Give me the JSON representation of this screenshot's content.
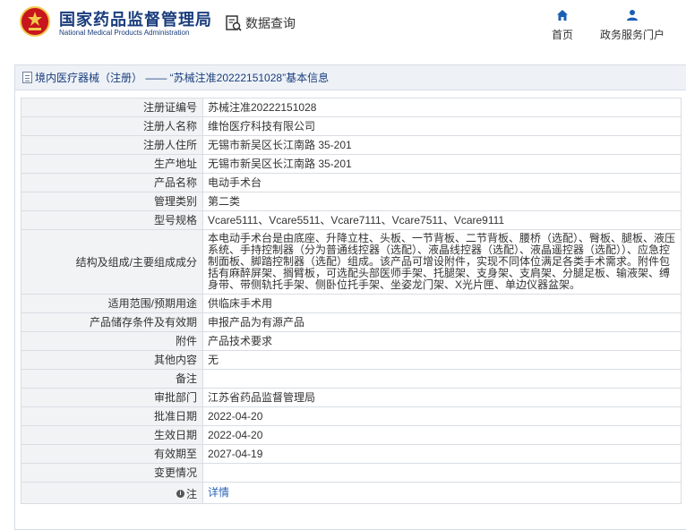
{
  "header": {
    "org_cn": "国家药品监督管理局",
    "org_en": "National Medical Products Administration",
    "query_label": "数据查询",
    "nav": [
      {
        "label": "首页",
        "icon": "home-icon"
      },
      {
        "label": "政务服务门户",
        "icon": "user-icon"
      }
    ]
  },
  "panel": {
    "title": "境内医疗器械（注册） —— “苏械注准20222151028”基本信息"
  },
  "rows": [
    {
      "key": "注册证编号",
      "value": "苏械注准20222151028"
    },
    {
      "key": "注册人名称",
      "value": "维怡医疗科技有限公司"
    },
    {
      "key": "注册人住所",
      "value": "无锡市新吴区长江南路 35-201"
    },
    {
      "key": "生产地址",
      "value": "无锡市新吴区长江南路 35-201"
    },
    {
      "key": "产品名称",
      "value": "电动手术台"
    },
    {
      "key": "管理类别",
      "value": "第二类"
    },
    {
      "key": "型号规格",
      "value": "Vcare5111、Vcare5511、Vcare7111、Vcare7511、Vcare9111"
    },
    {
      "key": "结构及组成/主要组成成分",
      "value": "本电动手术台是由底座、升降立柱、头板、一节背板、二节背板、腰桥（选配）、臀板、腿板、液压系统、手持控制器（分为普通线控器（选配）、液晶线控器（选配）、液晶遥控器（选配））、应急控制面板、脚踏控制器（选配）组成。该产品可增设附件，实现不同体位满足各类手术需求。附件包括有麻醉屏架、搁臂板，可选配头部医师手架、托腿架、支身架、支肩架、分腿足板、输液架、缚身带、带侧轨托手架、侧卧位托手架、坐姿龙门架、X光片匣、单边仪器盆架。"
    },
    {
      "key": "适用范围/预期用途",
      "value": "供临床手术用"
    },
    {
      "key": "产品储存条件及有效期",
      "value": "申报产品为有源产品"
    },
    {
      "key": "附件",
      "value": "产品技术要求"
    },
    {
      "key": "其他内容",
      "value": "无"
    },
    {
      "key": "备注",
      "value": ""
    },
    {
      "key": "审批部门",
      "value": "江苏省药品监督管理局"
    },
    {
      "key": "批准日期",
      "value": "2022-04-20"
    },
    {
      "key": "生效日期",
      "value": "2022-04-20"
    },
    {
      "key": "有效期至",
      "value": "2027-04-19"
    },
    {
      "key": "变更情况",
      "value": ""
    }
  ],
  "note_row": {
    "key": "注",
    "link": "详情"
  },
  "colors": {
    "brand": "#1a3d7c",
    "link": "#2a63b5",
    "key_bg": "#f2f3f5",
    "emblem_red": "#c8161d",
    "emblem_gold": "#f2c94c"
  }
}
